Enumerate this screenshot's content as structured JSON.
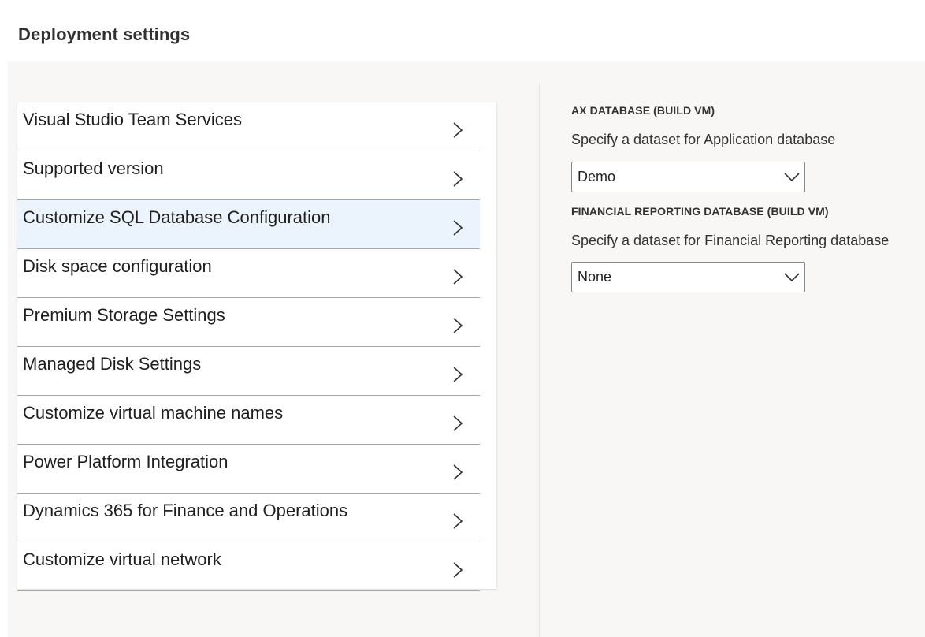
{
  "page": {
    "title": "Deployment settings"
  },
  "nav": {
    "items": [
      {
        "label": "Visual Studio Team Services",
        "selected": false
      },
      {
        "label": "Supported version",
        "selected": false
      },
      {
        "label": "Customize SQL Database Configuration",
        "selected": true
      },
      {
        "label": "Disk space configuration",
        "selected": false
      },
      {
        "label": "Premium Storage Settings",
        "selected": false
      },
      {
        "label": "Managed Disk Settings",
        "selected": false
      },
      {
        "label": "Customize virtual machine names",
        "selected": false
      },
      {
        "label": "Power Platform Integration",
        "selected": false
      },
      {
        "label": "Dynamics 365 for Finance and Operations",
        "selected": false
      },
      {
        "label": "Customize virtual network",
        "selected": false
      }
    ],
    "item_icon": "chevron-right-icon"
  },
  "settings": {
    "ax_database": {
      "label": "AX DATABASE (BUILD VM)",
      "description": "Specify a dataset for Application database",
      "selected_value": "Demo"
    },
    "financial_reporting_database": {
      "label": "FINANCIAL REPORTING DATABASE (BUILD VM)",
      "description": "Specify a dataset for Financial Reporting database",
      "selected_value": "None"
    }
  },
  "colors": {
    "selected_row": "#ebf3fc",
    "panel_background": "#f8f7f6",
    "row_border": "#a8a6a4"
  }
}
